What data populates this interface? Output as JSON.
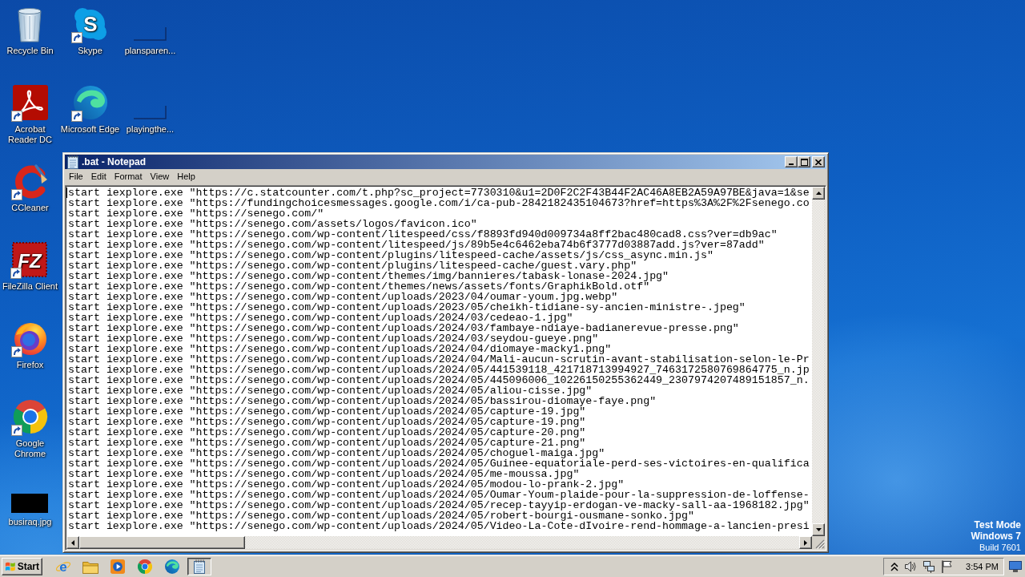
{
  "desktop": {
    "icon_columns": [
      [
        {
          "label": "Recycle Bin",
          "kind": "recycle-bin",
          "shortcut": false
        },
        {
          "label": "Acrobat Reader DC",
          "kind": "acrobat",
          "shortcut": true
        },
        {
          "label": "CCleaner",
          "kind": "ccleaner",
          "shortcut": true
        },
        {
          "label": "FileZilla Client",
          "kind": "filezilla",
          "logo_text": "FZ",
          "shortcut": true
        },
        {
          "label": "Firefox",
          "kind": "firefox",
          "shortcut": true
        },
        {
          "label": "Google Chrome",
          "kind": "chrome",
          "shortcut": true
        },
        {
          "label": "busiraq.jpg",
          "kind": "image",
          "shortcut": false
        }
      ],
      [
        {
          "label": "Skype",
          "kind": "skype",
          "logo_text": "S",
          "shortcut": true
        },
        {
          "label": "Microsoft Edge",
          "kind": "edge",
          "shortcut": true
        }
      ],
      [
        {
          "label": "plansparen...",
          "kind": "blank-file",
          "shortcut": false
        },
        {
          "label": "playingthe...",
          "kind": "blank-file",
          "shortcut": false
        }
      ]
    ]
  },
  "notepad": {
    "title": ".bat - Notepad",
    "menu": [
      "File",
      "Edit",
      "Format",
      "View",
      "Help"
    ],
    "lines": [
      "start iexplore.exe \"https://c.statcounter.com/t.php?sc_project=7730310&u1=2D0F2C2F43B44F2AC46A8EB2A59A97BE&java=1&se",
      "start iexplore.exe \"https://fundingchoicesmessages.google.com/i/ca-pub-2842182435104673?href=https%3A%2F%2Fsenego.co",
      "start iexplore.exe \"https://senego.com/\"",
      "start iexplore.exe \"https://senego.com/assets/logos/favicon.ico\"",
      "start iexplore.exe \"https://senego.com/wp-content/litespeed/css/f8893fd940d009734a8ff2bac480cad8.css?ver=db9ac\"",
      "start iexplore.exe \"https://senego.com/wp-content/litespeed/js/89b5e4c6462eba74b6f3777d03887add.js?ver=87add\"",
      "start iexplore.exe \"https://senego.com/wp-content/plugins/litespeed-cache/assets/js/css_async.min.js\"",
      "start iexplore.exe \"https://senego.com/wp-content/plugins/litespeed-cache/guest.vary.php\"",
      "start iexplore.exe \"https://senego.com/wp-content/themes/img/bannieres/tabask-lonase-2024.jpg\"",
      "start iexplore.exe \"https://senego.com/wp-content/themes/news/assets/fonts/GraphikBold.otf\"",
      "start iexplore.exe \"https://senego.com/wp-content/uploads/2023/04/oumar-youm.jpg.webp\"",
      "start iexplore.exe \"https://senego.com/wp-content/uploads/2023/05/cheikh-tidiane-sy-ancien-ministre-.jpeg\"",
      "start iexplore.exe \"https://senego.com/wp-content/uploads/2024/03/cedeao-1.jpg\"",
      "start iexplore.exe \"https://senego.com/wp-content/uploads/2024/03/fambaye-ndiaye-badianerevue-presse.png\"",
      "start iexplore.exe \"https://senego.com/wp-content/uploads/2024/03/seydou-gueye.png\"",
      "start iexplore.exe \"https://senego.com/wp-content/uploads/2024/04/diomaye-macky1.png\"",
      "start iexplore.exe \"https://senego.com/wp-content/uploads/2024/04/Mali-aucun-scrutin-avant-stabilisation-selon-le-Pr",
      "start iexplore.exe \"https://senego.com/wp-content/uploads/2024/05/441539118_421718713994927_7463172580769864775_n.jp",
      "start iexplore.exe \"https://senego.com/wp-content/uploads/2024/05/445096006_10226150255362449_2307974207489151857_n.",
      "start iexplore.exe \"https://senego.com/wp-content/uploads/2024/05/aliou-cisse.jpg\"",
      "start iexplore.exe \"https://senego.com/wp-content/uploads/2024/05/bassirou-diomaye-faye.png\"",
      "start iexplore.exe \"https://senego.com/wp-content/uploads/2024/05/capture-19.jpg\"",
      "start iexplore.exe \"https://senego.com/wp-content/uploads/2024/05/capture-19.png\"",
      "start iexplore.exe \"https://senego.com/wp-content/uploads/2024/05/capture-20.png\"",
      "start iexplore.exe \"https://senego.com/wp-content/uploads/2024/05/capture-21.png\"",
      "start iexplore.exe \"https://senego.com/wp-content/uploads/2024/05/choguel-maiga.jpg\"",
      "start iexplore.exe \"https://senego.com/wp-content/uploads/2024/05/Guinee-equatoriale-perd-ses-victoires-en-qualifica",
      "start iexplore.exe \"https://senego.com/wp-content/uploads/2024/05/me-moussa.jpg\"",
      "start iexplore.exe \"https://senego.com/wp-content/uploads/2024/05/modou-lo-prank-2.jpg\"",
      "start iexplore.exe \"https://senego.com/wp-content/uploads/2024/05/Oumar-Youm-plaide-pour-la-suppression-de-loffense-",
      "start iexplore.exe \"https://senego.com/wp-content/uploads/2024/05/recep-tayyip-erdogan-ve-macky-sall-aa-1968182.jpg\"",
      "start iexplore.exe \"https://senego.com/wp-content/uploads/2024/05/robert-bourgi-ousmane-sonko.jpg\"",
      "start iexplore.exe \"https://senego.com/wp-content/uploads/2024/05/Video-La-Cote-dIvoire-rend-hommage-a-lancien-presi"
    ]
  },
  "system_notice": [
    "Test Mode",
    "Windows 7",
    "Build 7601"
  ],
  "taskbar": {
    "start_label": "Start",
    "apps": [
      {
        "kind": "internet-explorer",
        "logo_text": "e",
        "selected": false
      },
      {
        "kind": "folder",
        "selected": false
      },
      {
        "kind": "media-player",
        "selected": false
      },
      {
        "kind": "chrome",
        "selected": false
      },
      {
        "kind": "edge",
        "selected": false
      },
      {
        "kind": "notepad",
        "selected": true
      }
    ],
    "clock": "3:54 PM"
  }
}
